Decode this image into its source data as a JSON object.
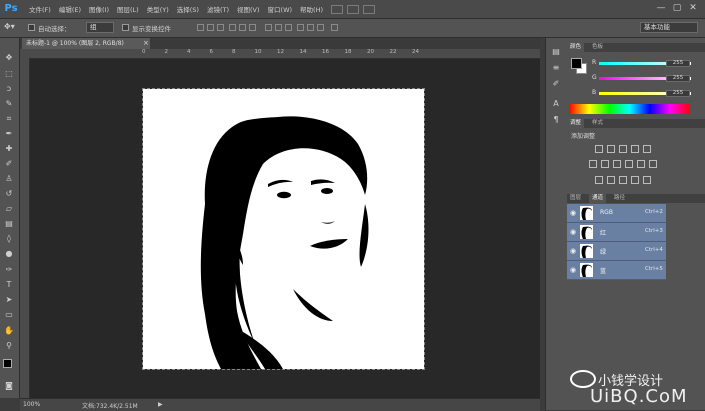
{
  "app": {
    "logo": "Ps"
  },
  "menu": [
    "文件(F)",
    "编辑(E)",
    "图像(I)",
    "图层(L)",
    "类型(Y)",
    "选择(S)",
    "滤镜(T)",
    "视图(V)",
    "窗口(W)",
    "帮助(H)"
  ],
  "window_controls": [
    "—",
    "▢",
    "✕"
  ],
  "options_bar": {
    "auto_select_label": "自动选择：",
    "auto_select_value": "组",
    "show_transform_label": "显示变换控件",
    "workspace_value": "基本功能"
  },
  "document": {
    "tab_title": "未标题-1 @ 100% (图层 2, RGB/8)",
    "close_glyph": "×",
    "ruler_top_ticks": [
      "0",
      "2",
      "4",
      "6",
      "8",
      "10",
      "12",
      "14",
      "16",
      "18",
      "20",
      "22",
      "24"
    ]
  },
  "status": {
    "zoom": "100%",
    "doc_size": "文档:732.4K/2.51M",
    "arrow": "▶"
  },
  "color_panel": {
    "tabs": [
      "颜色",
      "色板"
    ],
    "channels": [
      {
        "label": "R",
        "value": "255",
        "color": "#ff3c3c"
      },
      {
        "label": "G",
        "value": "255",
        "color": "#3cff3c"
      },
      {
        "label": "B",
        "value": "255",
        "color": "#3c6cff"
      }
    ]
  },
  "adjust_panel": {
    "tabs": [
      "调整",
      "样式"
    ],
    "add_label": "添加调整"
  },
  "channels_panel": {
    "tabs": [
      "图层",
      "通道",
      "路径"
    ],
    "rows": [
      {
        "name": "RGB",
        "shortcut": "Ctrl+2"
      },
      {
        "name": "红",
        "shortcut": "Ctrl+3"
      },
      {
        "name": "绿",
        "shortcut": "Ctrl+4"
      },
      {
        "name": "蓝",
        "shortcut": "Ctrl+5"
      }
    ]
  },
  "watermark": {
    "text": "小钱学设计",
    "url": "UiBQ.CoM"
  }
}
